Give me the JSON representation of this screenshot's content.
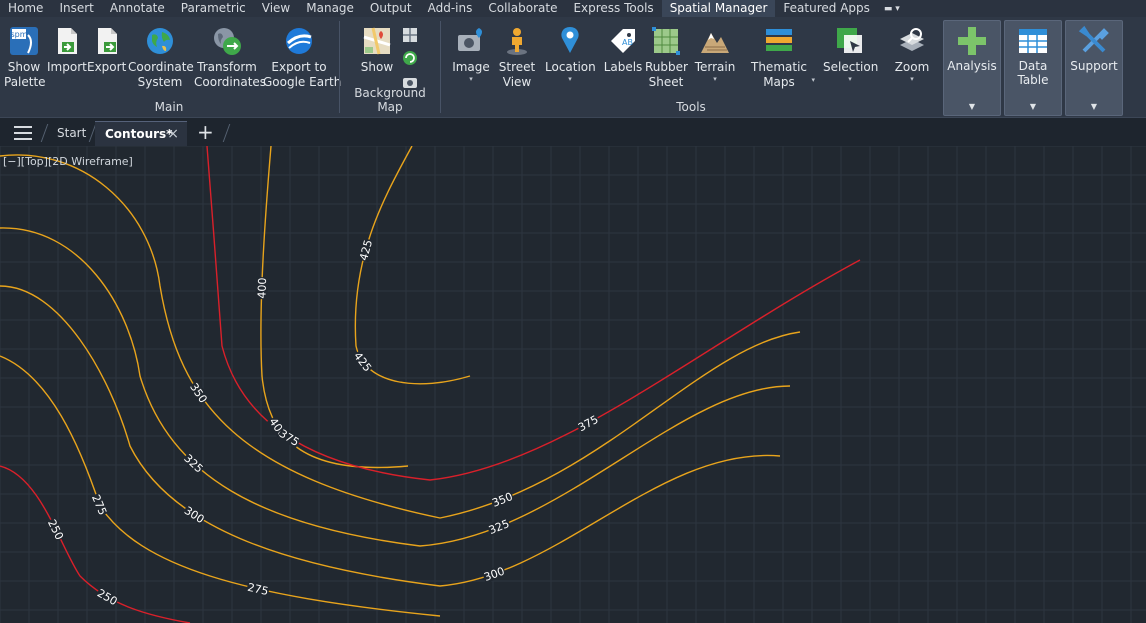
{
  "menubar": {
    "items": [
      "Home",
      "Insert",
      "Annotate",
      "Parametric",
      "View",
      "Manage",
      "Output",
      "Add-ins",
      "Collaborate",
      "Express Tools",
      "Spatial Manager",
      "Featured Apps"
    ],
    "active": "Spatial Manager"
  },
  "ribbon": {
    "main": {
      "title": "Main",
      "tools": [
        {
          "line1": "Show",
          "line2": "Palette",
          "icon": "spm-palette-icon"
        },
        {
          "line1": "Import",
          "line2": "",
          "icon": "import-icon"
        },
        {
          "line1": "Export",
          "line2": "",
          "icon": "export-icon"
        },
        {
          "line1": "Coordinate",
          "line2": "System",
          "icon": "globe-icon"
        },
        {
          "line1": "Transform",
          "line2": "Coordinates",
          "icon": "transform-globe-icon"
        },
        {
          "line1": "Export to",
          "line2": "Google Earth",
          "icon": "google-earth-icon"
        }
      ]
    },
    "background_map": {
      "title": "Background Map",
      "show_label": "Show"
    },
    "tools": {
      "title": "Tools",
      "items": [
        {
          "line1": "Image",
          "line2": "",
          "icon": "image-camera-icon",
          "dropdown": true
        },
        {
          "line1": "Street",
          "line2": "View",
          "icon": "street-view-icon",
          "dropdown": false
        },
        {
          "line1": "Location",
          "line2": "",
          "icon": "location-pin-icon",
          "dropdown": true
        },
        {
          "line1": "Labels",
          "line2": "",
          "icon": "labels-icon",
          "dropdown": false
        },
        {
          "line1": "Rubber",
          "line2": "Sheet",
          "icon": "rubber-sheet-icon",
          "dropdown": false
        },
        {
          "line1": "Terrain",
          "line2": "",
          "icon": "terrain-icon",
          "dropdown": true
        },
        {
          "line1": "Thematic",
          "line2": "Maps",
          "icon": "thematic-maps-icon",
          "dropdown": true
        },
        {
          "line1": "Selection",
          "line2": "",
          "icon": "selection-icon",
          "dropdown": true
        },
        {
          "line1": "Zoom",
          "line2": "",
          "icon": "zoom-icon",
          "dropdown": true
        }
      ]
    },
    "blocks": [
      {
        "label": "Analysis",
        "icon": "analysis-plus-icon"
      },
      {
        "label": "Data Table",
        "icon": "data-table-icon"
      },
      {
        "label": "Support",
        "icon": "support-tools-icon"
      }
    ]
  },
  "tabs": {
    "start": "Start",
    "active": "Contours*",
    "close": "×",
    "new": "+"
  },
  "viewport": {
    "label": "[−][Top][2D Wireframe]"
  },
  "colors": {
    "background": "#212830",
    "grid": "#2d3640",
    "contour_minor": "#e8a41c",
    "contour_major": "#d9202a",
    "label": "#ffffff"
  },
  "contours": [
    {
      "value": 400,
      "color": "minor",
      "labels": [
        "400",
        "400"
      ]
    },
    {
      "value": 425,
      "color": "minor",
      "labels": [
        "425",
        "425"
      ]
    },
    {
      "value": 375,
      "color": "major",
      "labels": [
        "375",
        "375"
      ]
    },
    {
      "value": 350,
      "color": "minor",
      "labels": [
        "350",
        "350"
      ]
    },
    {
      "value": 325,
      "color": "minor",
      "labels": [
        "325",
        "325"
      ]
    },
    {
      "value": 300,
      "color": "minor",
      "labels": [
        "300",
        "300"
      ]
    },
    {
      "value": 275,
      "color": "minor",
      "labels": [
        "275",
        "275"
      ]
    },
    {
      "value": 250,
      "color": "major",
      "labels": [
        "250",
        "250"
      ]
    }
  ]
}
